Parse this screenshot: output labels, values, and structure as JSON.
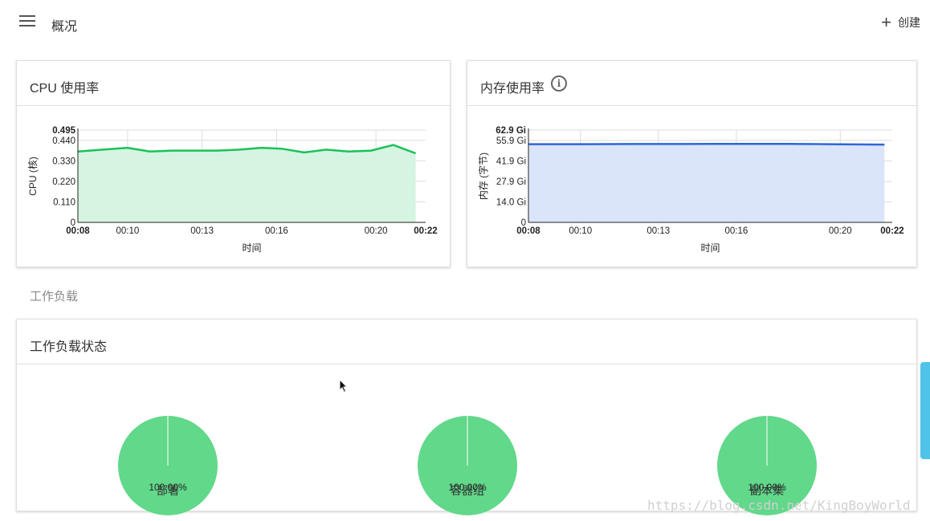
{
  "header": {
    "title": "概况",
    "create_label": "创建"
  },
  "cpu_card": {
    "title": "CPU 使用率"
  },
  "memory_card": {
    "title": "内存使用率"
  },
  "workloads": {
    "section_label": "工作负载",
    "card_title": "工作负载状态",
    "pies": [
      {
        "label": "部署",
        "percent_text": "100.00%",
        "value": 100
      },
      {
        "label": "容器组",
        "percent_text": "100.00%",
        "value": 100
      },
      {
        "label": "副本集",
        "percent_text": "100.00%",
        "value": 100
      }
    ],
    "pie_color": "#61d88a"
  },
  "watermark": "https://blog.csdn.net/KingBoyWorld",
  "chart_data": [
    {
      "type": "area",
      "ylabel": "CPU (核)",
      "xlabel": "时间",
      "y_ticks": [
        "0",
        "0.110",
        "0.220",
        "0.330",
        "0.440",
        "0.495"
      ],
      "y_tick_values": [
        0,
        0.11,
        0.22,
        0.33,
        0.44,
        0.495
      ],
      "ylim": [
        0,
        0.495
      ],
      "x_ticks": [
        "00:08",
        "00:10",
        "00:13",
        "00:16",
        "00:20",
        "00:22"
      ],
      "x_tick_values": [
        8,
        10,
        13,
        16,
        20,
        22
      ],
      "xlim": [
        8,
        22
      ],
      "grid": true,
      "line_color": "#19c25a",
      "fill_color": "#d3f3df",
      "series": [
        {
          "x": [
            8,
            9,
            10,
            10.9,
            11.8,
            12.7,
            13.6,
            14.5,
            15.4,
            16.2,
            17.1,
            18.0,
            18.9,
            19.8,
            20.7,
            21.6
          ],
          "values": [
            0.38,
            0.39,
            0.4,
            0.38,
            0.385,
            0.385,
            0.385,
            0.39,
            0.4,
            0.395,
            0.375,
            0.39,
            0.38,
            0.385,
            0.415,
            0.37
          ]
        }
      ]
    },
    {
      "type": "area",
      "ylabel": "内存 (字节)",
      "xlabel": "时间",
      "y_ticks": [
        "0",
        "14.0 Gi",
        "27.9 Gi",
        "41.9 Gi",
        "55.9 Gi",
        "62.9 Gi"
      ],
      "y_tick_values": [
        0,
        14.0,
        27.9,
        41.9,
        55.9,
        62.9
      ],
      "ylim": [
        0,
        62.9
      ],
      "x_ticks": [
        "00:08",
        "00:10",
        "00:13",
        "00:16",
        "00:20",
        "00:22"
      ],
      "x_tick_values": [
        8,
        10,
        13,
        16,
        20,
        22
      ],
      "xlim": [
        8,
        22
      ],
      "grid": true,
      "line_color": "#2f66d8",
      "fill_color": "#d8e4f9",
      "series": [
        {
          "x": [
            8,
            10,
            12,
            14,
            16,
            18,
            20,
            21.7
          ],
          "values": [
            53.3,
            53.3,
            53.4,
            53.4,
            53.5,
            53.5,
            53.2,
            53.0
          ]
        }
      ]
    }
  ]
}
